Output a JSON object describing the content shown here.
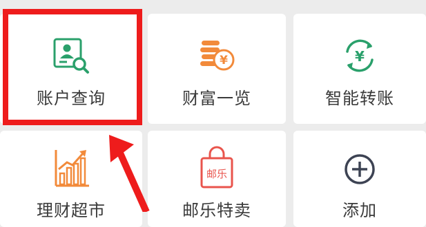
{
  "menu": {
    "tiles": [
      {
        "label": "账户查询",
        "icon": "account-search-icon"
      },
      {
        "label": "财富一览",
        "icon": "coins-yen-icon"
      },
      {
        "label": "智能转账",
        "icon": "yen-exchange-icon"
      },
      {
        "label": "理财超市",
        "icon": "growth-chart-icon"
      },
      {
        "label": "邮乐特卖",
        "icon": "shopping-bag-icon"
      },
      {
        "label": "添加",
        "icon": "add-circle-icon"
      }
    ],
    "bag_text": "邮乐"
  },
  "colors": {
    "green": "#2aa06b",
    "orange": "#f28a3a",
    "red_highlight": "#ee1c1c",
    "red_bag": "#e9544c",
    "dark_icon": "#3d4353"
  }
}
